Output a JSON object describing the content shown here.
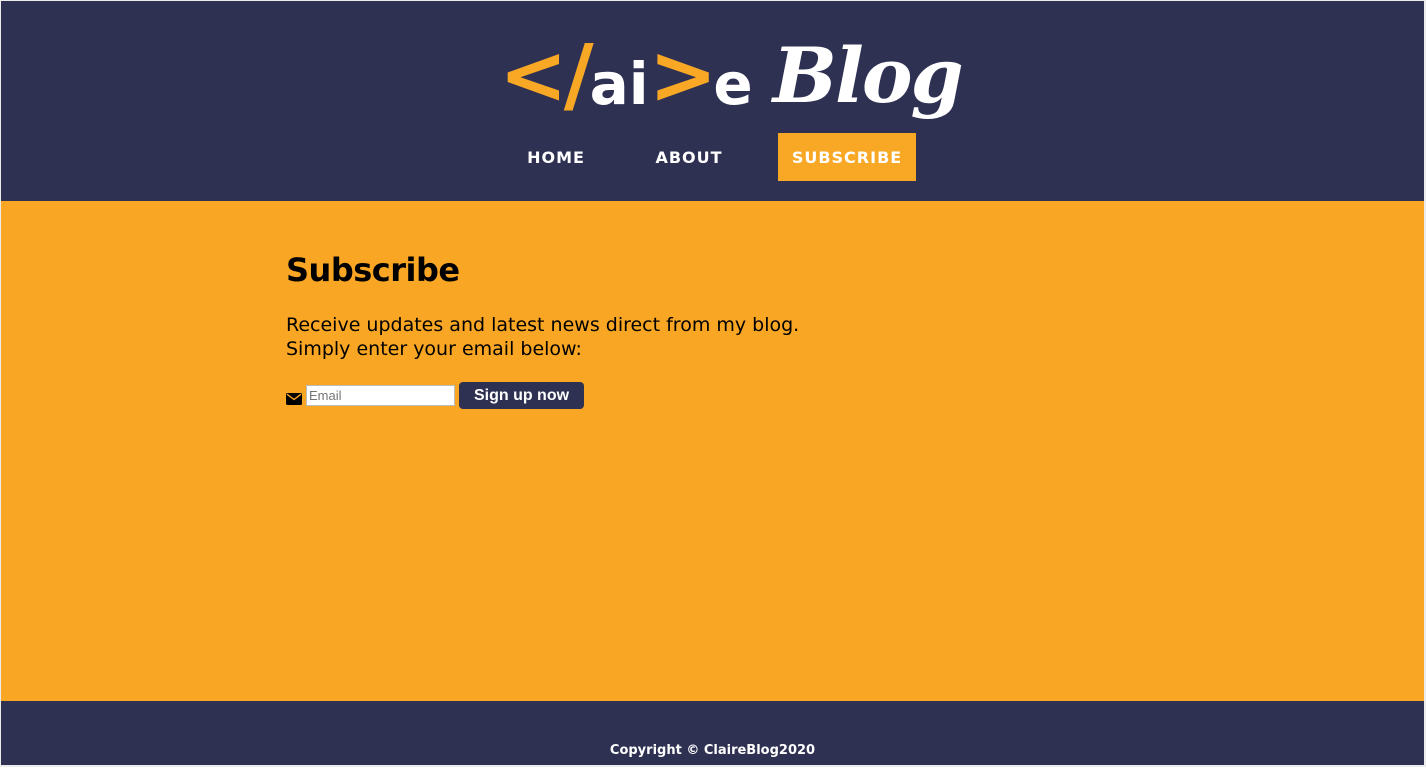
{
  "header": {
    "logo": {
      "open_bracket": "</",
      "letters_mid": "ai",
      "close_bracket": ">",
      "letter_end": "e",
      "word": "Blog"
    },
    "nav": [
      {
        "label": "HOME"
      },
      {
        "label": "ABOUT"
      },
      {
        "label": "SUBSCRIBE"
      }
    ]
  },
  "main": {
    "title": "Subscribe",
    "intro_line1": "Receive updates and latest news direct from my blog.",
    "intro_line2": "Simply enter your email below:",
    "form": {
      "email_placeholder": "Email",
      "email_value": "",
      "submit_label": "Sign up now",
      "icon": "envelope-icon"
    }
  },
  "footer": {
    "copyright": "Copyright © ClaireBlog2020"
  },
  "colors": {
    "navy": "#2e3152",
    "orange": "#f9a624",
    "accent": "#f9a825",
    "white": "#ffffff"
  }
}
